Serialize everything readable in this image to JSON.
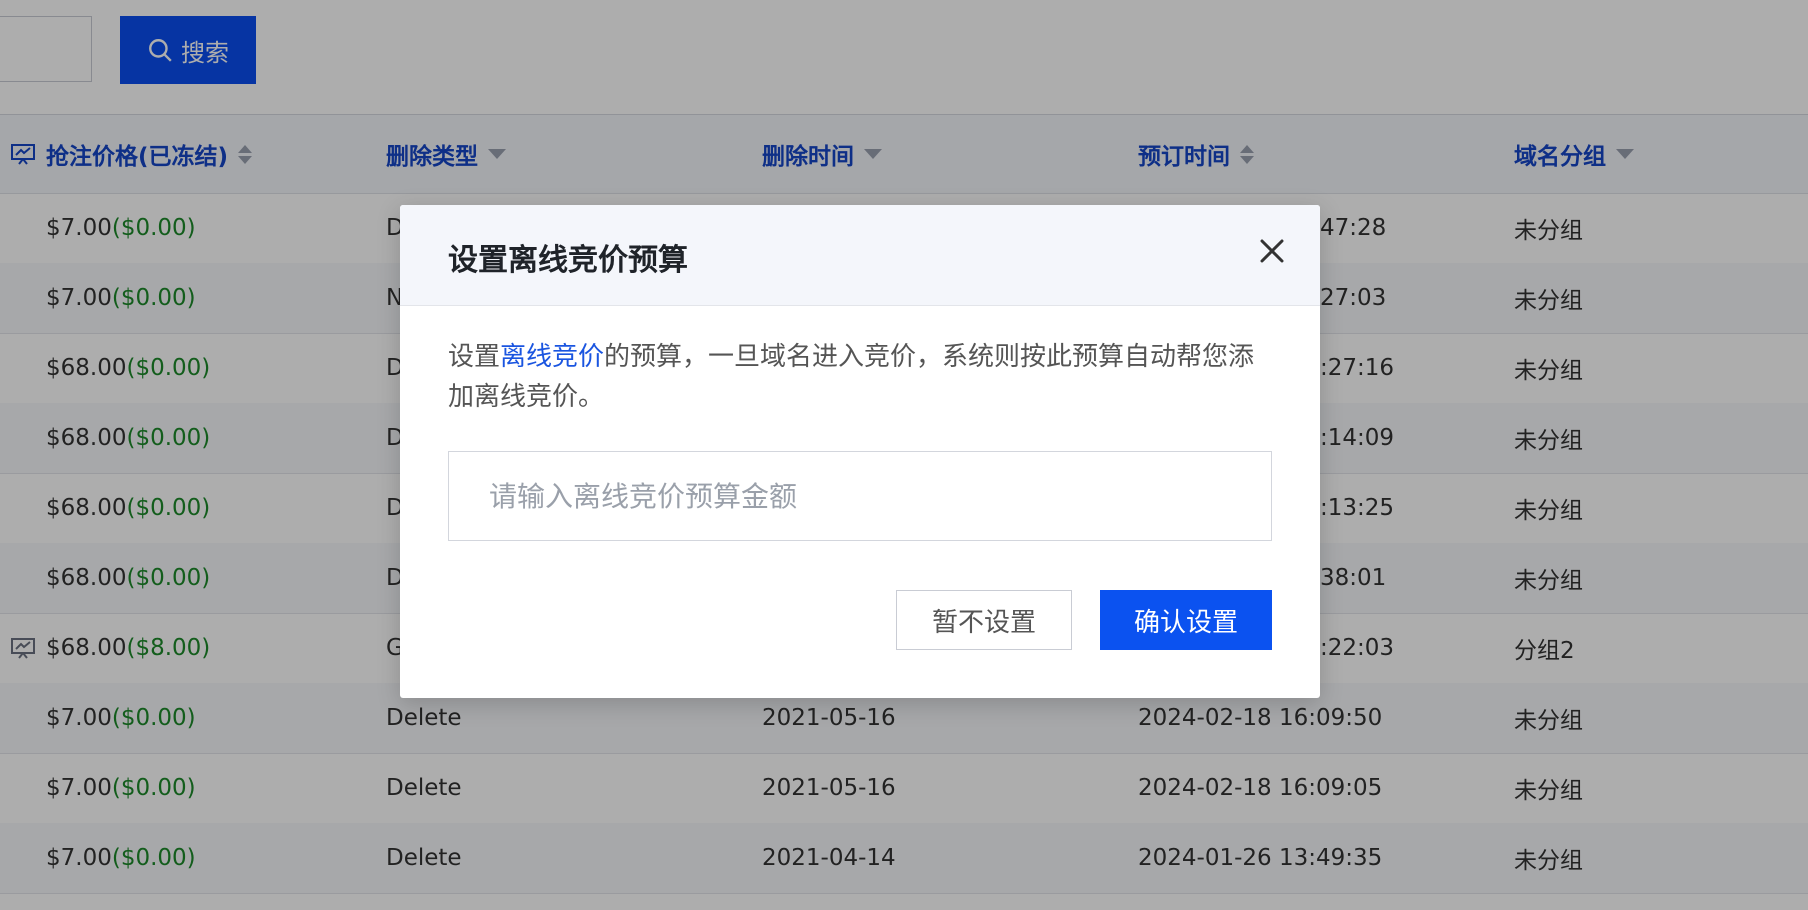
{
  "toolbar": {
    "search_label": "搜索"
  },
  "table": {
    "headers": {
      "price": "抢注价格(已冻结)",
      "delete_type": "删除类型",
      "delete_time": "删除时间",
      "reserve_time": "预订时间",
      "group": "域名分组"
    },
    "rows": [
      {
        "price": "$7.00",
        "frozen": "($0.00)",
        "delete_type": "D",
        "delete_time": "",
        "reserve_time": "47:28",
        "group": "未分组"
      },
      {
        "price": "$7.00",
        "frozen": "($0.00)",
        "delete_type": "N",
        "delete_time": "",
        "reserve_time": "27:03",
        "group": "未分组"
      },
      {
        "price": "$68.00",
        "frozen": "($0.00)",
        "delete_type": "D",
        "delete_time": "",
        "reserve_time": ":27:16",
        "group": "未分组"
      },
      {
        "price": "$68.00",
        "frozen": "($0.00)",
        "delete_type": "D",
        "delete_time": "",
        "reserve_time": ":14:09",
        "group": "未分组"
      },
      {
        "price": "$68.00",
        "frozen": "($0.00)",
        "delete_type": "D",
        "delete_time": "",
        "reserve_time": ":13:25",
        "group": "未分组"
      },
      {
        "price": "$68.00",
        "frozen": "($0.00)",
        "delete_type": "D",
        "delete_time": "",
        "reserve_time": "38:01",
        "group": "未分组"
      },
      {
        "price": "$68.00",
        "frozen": "($8.00)",
        "delete_type": "G",
        "delete_time": "",
        "reserve_time": ":22:03",
        "group": "分组2"
      },
      {
        "price": "$7.00",
        "frozen": "($0.00)",
        "delete_type": "Delete",
        "delete_time": "2021-05-16",
        "reserve_time": "2024-02-18 16:09:50",
        "group": "未分组"
      },
      {
        "price": "$7.00",
        "frozen": "($0.00)",
        "delete_type": "Delete",
        "delete_time": "2021-05-16",
        "reserve_time": "2024-02-18 16:09:05",
        "group": "未分组"
      },
      {
        "price": "$7.00",
        "frozen": "($0.00)",
        "delete_type": "Delete",
        "delete_time": "2021-04-14",
        "reserve_time": "2024-01-26 13:49:35",
        "group": "未分组"
      }
    ]
  },
  "dialog": {
    "title": "设置离线竞价预算",
    "desc_prefix": "设置",
    "desc_link": "离线竞价",
    "desc_suffix": "的预算，一旦域名进入竞价，系统则按此预算自动帮您添加离线竞价。",
    "input_placeholder": "请输入离线竞价预算金额",
    "input_value": "",
    "cancel_label": "暂不设置",
    "confirm_label": "确认设置"
  }
}
